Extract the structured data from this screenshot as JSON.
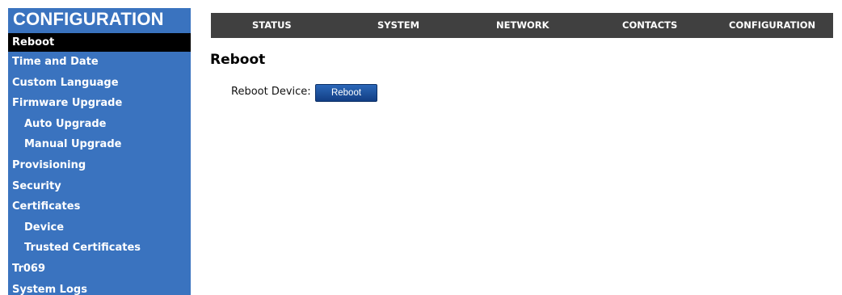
{
  "sidebar": {
    "title": "CONFIGURATION",
    "items": [
      {
        "label": "Reboot"
      },
      {
        "label": "Time and Date"
      },
      {
        "label": "Custom Language"
      },
      {
        "label": "Firmware Upgrade"
      },
      {
        "label": "Auto Upgrade"
      },
      {
        "label": "Manual Upgrade"
      },
      {
        "label": "Provisioning"
      },
      {
        "label": "Security"
      },
      {
        "label": "Certificates"
      },
      {
        "label": "Device"
      },
      {
        "label": "Trusted Certificates"
      },
      {
        "label": "Tr069"
      },
      {
        "label": "System Logs"
      }
    ]
  },
  "topnav": {
    "items": [
      {
        "label": "STATUS"
      },
      {
        "label": "SYSTEM"
      },
      {
        "label": "NETWORK"
      },
      {
        "label": "CONTACTS"
      },
      {
        "label": "CONFIGURATION"
      }
    ]
  },
  "main": {
    "title": "Reboot",
    "reboot_label": "Reboot Device:",
    "reboot_button": "Reboot"
  },
  "colors": {
    "sidebar_bg": "#3a73bf",
    "active_bg": "#000000",
    "nav_bg": "#404040",
    "button_bg": "#1d4f9a"
  }
}
